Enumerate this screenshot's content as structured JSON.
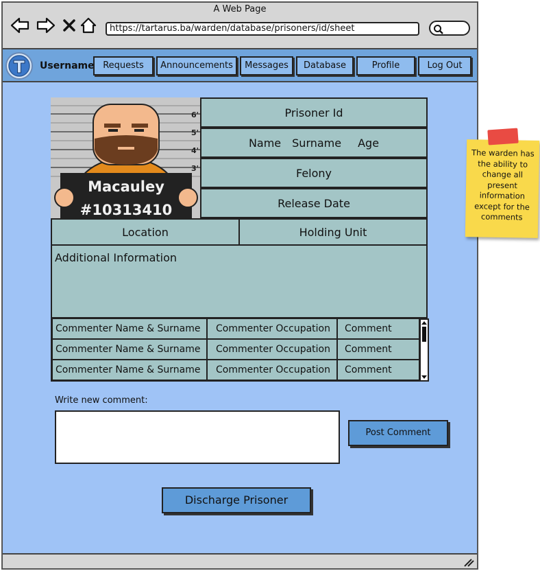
{
  "window": {
    "title": "A Web Page"
  },
  "browser": {
    "url": "https://tartarus.ba/warden/database/prisoners/id/sheet",
    "search_placeholder": ""
  },
  "nav": {
    "username": "Username",
    "items": [
      {
        "label": "Requests"
      },
      {
        "label": "Announcements"
      },
      {
        "label": "Messages"
      },
      {
        "label": "Database"
      },
      {
        "label": "Profile"
      },
      {
        "label": "Log Out"
      }
    ]
  },
  "prisoner": {
    "photo": {
      "name": "Macauley",
      "number": "#10313410",
      "height_marks": [
        "6'",
        "5'",
        "4'",
        "3'"
      ]
    },
    "id_label": "Prisoner Id",
    "name_label": "Name",
    "surname_label": "Surname",
    "age_label": "Age",
    "felony_label": "Felony",
    "release_label": "Release Date",
    "location_label": "Location",
    "holding_unit_label": "Holding Unit",
    "additional_info_label": "Additional Information"
  },
  "comments": {
    "rows": [
      {
        "name": "Commenter Name & Surname",
        "occupation": "Commenter Occupation",
        "comment": "Comment"
      },
      {
        "name": "Commenter Name & Surname",
        "occupation": "Commenter Occupation",
        "comment": "Comment"
      },
      {
        "name": "Commenter Name & Surname",
        "occupation": "Commenter Occupation",
        "comment": "Comment"
      }
    ],
    "write_label": "Write new comment:",
    "new_comment_value": "",
    "post_button": "Post Comment"
  },
  "actions": {
    "discharge_button": "Discharge Prisoner"
  },
  "note": {
    "text": "The warden has the ability to change all present information except for the comments"
  },
  "colors": {
    "page_bg": "#9fc3f6",
    "navbar": "#6fa4dc",
    "cell": "#a3c5c6",
    "button": "#5e9bd8",
    "sticky": "#f9d94b",
    "tape": "#e94b43"
  }
}
